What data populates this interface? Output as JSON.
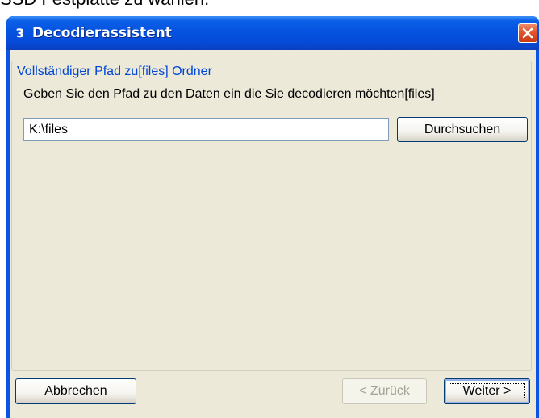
{
  "background_text": "SSD Festplatte zu wählen.",
  "window": {
    "title": "Decodierassistent",
    "icon": "app-logo-icon"
  },
  "groupbox": {
    "legend": "Vollständiger Pfad zu[files] Ordner",
    "instruction": "Geben Sie den Pfad zu den Daten ein die Sie decodieren möchten[files]",
    "path_value": "K:\\files",
    "browse_label": "Durchsuchen"
  },
  "buttons": {
    "cancel_label": "Abbrechen",
    "back_label": "< Zurück",
    "next_label": "Weiter >"
  },
  "colors": {
    "titlebar": "#0553e1",
    "close_button": "#e2542c",
    "dialog_background": "#ece9d8",
    "legend_text": "#0046d5"
  }
}
